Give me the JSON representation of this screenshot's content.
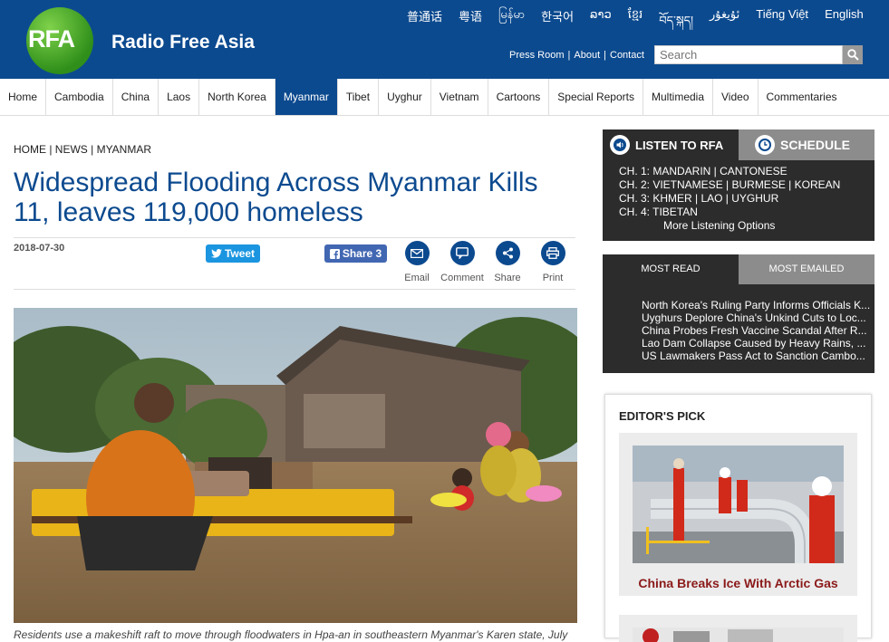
{
  "header": {
    "logo_text": "RFA",
    "site_name": "Radio Free Asia",
    "languages": [
      "普通话",
      "粤语",
      "မြန်မာ",
      "한국어",
      "ລາວ",
      "ខ្មែរ",
      "བོད་སྐད།",
      "ئۇيغۇر",
      "Tiếng Việt",
      "English"
    ],
    "top_links": [
      "Press Room",
      "About",
      "Contact"
    ],
    "search_placeholder": "Search"
  },
  "nav": {
    "items": [
      "Home",
      "Cambodia",
      "China",
      "Laos",
      "North Korea",
      "Myanmar",
      "Tibet",
      "Uyghur",
      "Vietnam",
      "Cartoons",
      "Special Reports",
      "Multimedia",
      "Video",
      "Commentaries"
    ],
    "active": "Myanmar"
  },
  "article": {
    "breadcrumb": "HOME | NEWS | MYANMAR",
    "title": "Widespread Flooding Across Myanmar Kills 11, leaves 119,000 homeless",
    "date": "2018-07-30",
    "tweet_label": "Tweet",
    "share_label": "Share 3",
    "tools": [
      "Email",
      "Comment",
      "Share",
      "Print"
    ],
    "caption": "Residents use a makeshift raft to move through floodwaters in Hpa-an in southeastern Myanmar's Karen state, July"
  },
  "listen": {
    "listen_tab": "LISTEN TO RFA",
    "schedule_tab": "SCHEDULE",
    "channels": [
      "CH. 1: MANDARIN | CANTONESE",
      "CH. 2: VIETNAMESE | BURMESE | KOREAN",
      "CH. 3: KHMER | LAO | UYGHUR",
      "CH. 4: TIBETAN"
    ],
    "more": "More Listening Options"
  },
  "most": {
    "tab_read": "MOST READ",
    "tab_emailed": "MOST EMAILED",
    "items": [
      "North Korea's Ruling Party Informs Officials K...",
      "Uyghurs Deplore China's Unkind Cuts to Loc...",
      "China Probes Fresh Vaccine Scandal After R...",
      "Lao Dam Collapse Caused by Heavy Rains, ...",
      "US Lawmakers Pass Act to Sanction Cambo..."
    ]
  },
  "editors_pick": {
    "heading": "EDITOR'S PICK",
    "story_title": "China Breaks Ice With Arctic Gas"
  },
  "colors": {
    "brand_blue": "#0c4a8f",
    "dark_panel": "#2c2c2c",
    "tab_gray": "#8c8c8c",
    "pick_red": "#8b1a1a"
  }
}
